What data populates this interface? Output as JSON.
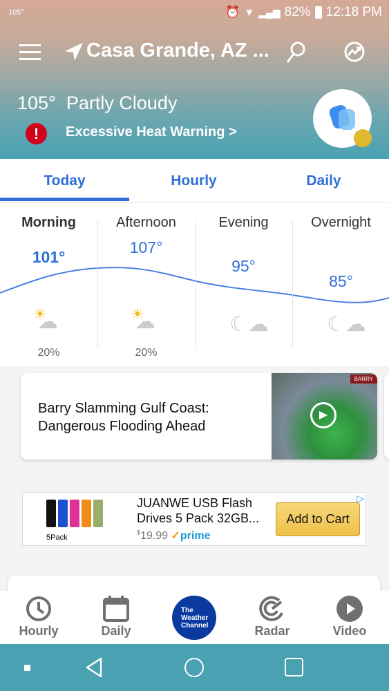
{
  "status_bar": {
    "left_temp": "105°",
    "battery": "82%",
    "time": "12:18 PM"
  },
  "header": {
    "location": "Casa Grande, AZ ...",
    "current_temp": "105°",
    "condition": "Partly Cloudy",
    "alert": "Excessive Heat Warning >"
  },
  "tabs": [
    {
      "label": "Today",
      "active": true
    },
    {
      "label": "Hourly"
    },
    {
      "label": "Daily"
    }
  ],
  "forecast": [
    {
      "period": "Morning",
      "temp": "101°",
      "precip": "20%",
      "icon": "partly-sunny-icon",
      "bold": true
    },
    {
      "period": "Afternoon",
      "temp": "107°",
      "precip": "20%",
      "icon": "partly-sunny-icon"
    },
    {
      "period": "Evening",
      "temp": "95°",
      "precip": "",
      "icon": "moon-cloud-icon"
    },
    {
      "period": "Overnight",
      "temp": "85°",
      "precip": "",
      "icon": "moon-cloud-icon"
    }
  ],
  "news": {
    "headline": "Barry Slamming Gulf Coast: Dangerous Flooding Ahead",
    "thumb_label": "BARRY"
  },
  "ad": {
    "product": "JUANWE USB Flash Drives 5 Pack 32GB...",
    "image_label": "5Pack",
    "price_symbol": "$",
    "price": "19.99",
    "prime": "prime",
    "button": "Add to Cart"
  },
  "bottom_nav": [
    {
      "label": "Hourly"
    },
    {
      "label": "Daily"
    },
    {
      "label": "The Weather Channel"
    },
    {
      "label": "Radar"
    },
    {
      "label": "Video"
    }
  ],
  "colors": {
    "accent": "#2f6fd6",
    "alert": "#d0021b",
    "twc_blue": "#0a3aa0",
    "cart": "#f0c14b"
  }
}
